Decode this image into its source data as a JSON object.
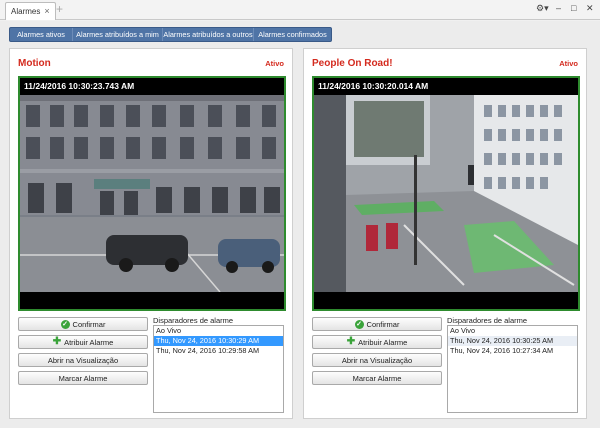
{
  "tab": {
    "label": "Alarmes"
  },
  "filters": [
    {
      "label": "Alarmes ativos",
      "w": 62
    },
    {
      "label": "Alarmes atribuídos a mim",
      "w": 90
    },
    {
      "label": "Alarmes atribuídos a outros",
      "w": 91
    },
    {
      "label": "Alarmes confirmados",
      "w": 78
    }
  ],
  "panels": [
    {
      "title": "Motion",
      "status": "Ativo",
      "timestamp": "11/24/2016 10:30:23.743 AM",
      "actions": {
        "confirm": "Confirmar",
        "assign": "Atribuir Alarme",
        "open": "Abrir na Visualização",
        "mark": "Marcar Alarme"
      },
      "triggers_label": "Disparadores de alarme",
      "triggers": [
        "Ao Vivo",
        "Thu, Nov 24, 2016 10:30:29 AM",
        "Thu, Nov 24, 2016 10:29:58 AM"
      ]
    },
    {
      "title": "People On Road!",
      "status": "Ativo",
      "timestamp": "11/24/2016 10:30:20.014 AM",
      "actions": {
        "confirm": "Confirmar",
        "assign": "Atribuir Alarme",
        "open": "Abrir na Visualização",
        "mark": "Marcar Alarme"
      },
      "triggers_label": "Disparadores de alarme",
      "triggers": [
        "Ao Vivo",
        "Thu, Nov 24, 2016 10:30:25 AM",
        "Thu, Nov 24, 2016 10:27:34 AM"
      ]
    }
  ],
  "colors": {
    "accent_blue": "#4f74a6",
    "alarm_red": "#d42a1e",
    "video_border_green": "#2e8b2e",
    "selection_blue": "#3399ff"
  },
  "icons": {
    "tab_close": "×",
    "tab_add": "+",
    "settings": "⚙▾",
    "minimize": "–",
    "maximize": "□",
    "close": "✕",
    "check": "✓",
    "plus": "✚"
  }
}
